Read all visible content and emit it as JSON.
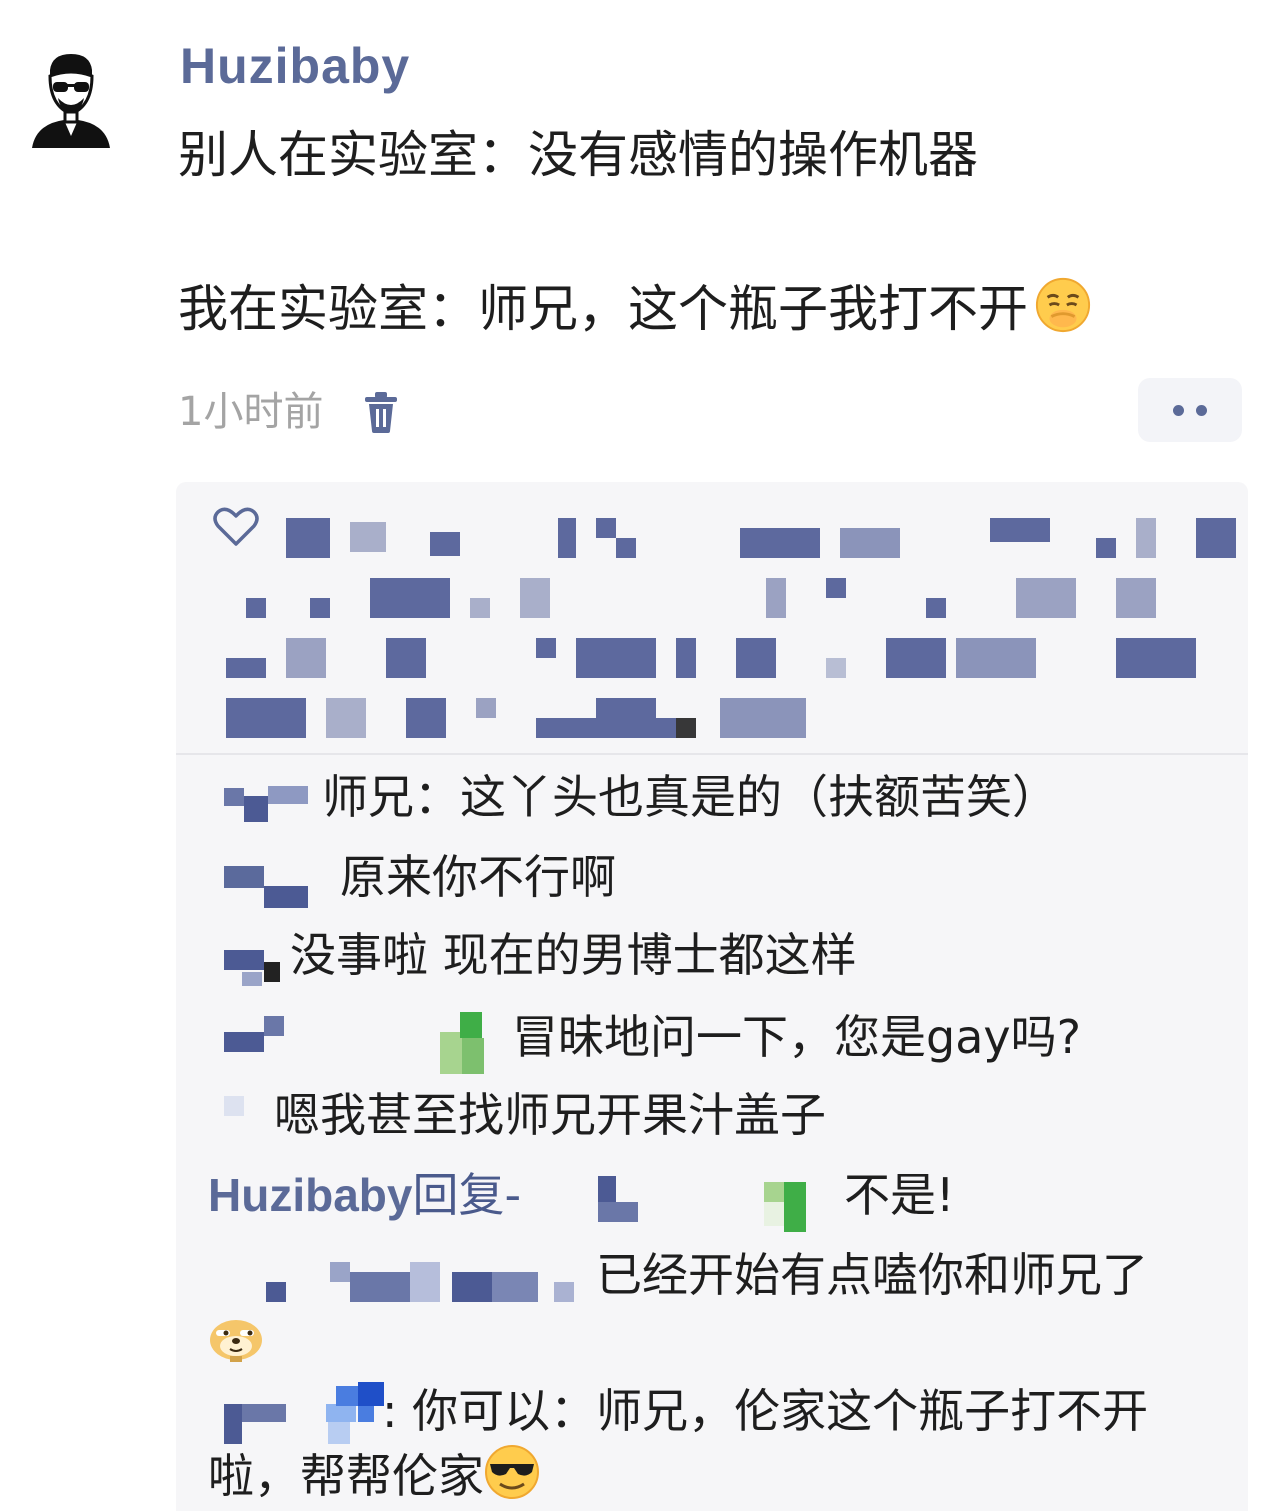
{
  "post": {
    "author": "Huzibaby",
    "line1": "别人在实验室：没有感情的操作机器",
    "line2": "我在实验室：师兄，这个瓶子我打不开",
    "line2_emoji": "worried-face-emoji",
    "timestamp": "1小时前",
    "icons": {
      "avatar": "avatar-icon",
      "delete": "trash-icon",
      "more": "more-dots-icon",
      "like": "heart-icon"
    }
  },
  "comments": [
    {
      "text": "师兄：这丫头也真是的（扶额苦笑）"
    },
    {
      "text": "原来你不行啊"
    },
    {
      "text": "没事啦 现在的男博士都这样"
    },
    {
      "text": "冒昧地问一下，您是gay吗?"
    },
    {
      "text": "嗯我甚至找师兄开果汁盖子"
    },
    {
      "reply_author": "Huzibaby",
      "reply_word": "回复-",
      "text": "不是!"
    },
    {
      "text": "已经开始有点嗑你和师兄了",
      "emoji": "doge-emoji"
    },
    {
      "text_line1": ": 你可以：师兄，伦家这个瓶子打不开",
      "text_line2": "啦，帮帮伦家",
      "emoji": "sunglasses-emoji"
    }
  ],
  "colors": {
    "accent": "#5b6a98",
    "text": "#1e1e1e",
    "muted": "#a4a4a4",
    "panel": "#f6f6f8"
  }
}
